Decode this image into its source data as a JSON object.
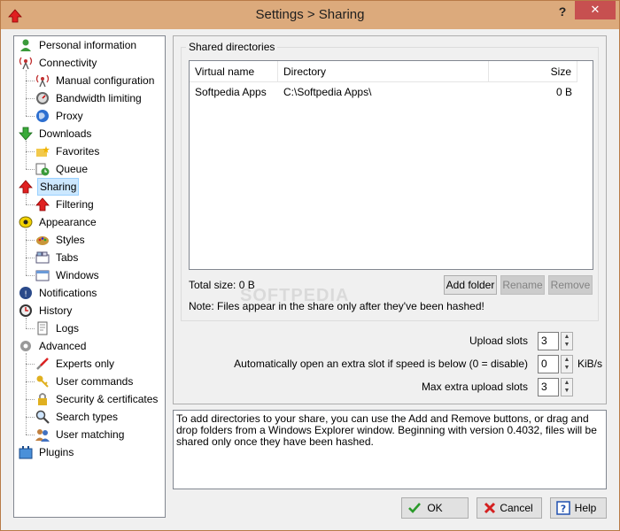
{
  "window": {
    "title": "Settings > Sharing",
    "help_label": "?",
    "close_label": "✕"
  },
  "tree": [
    {
      "label": "Personal information",
      "icon": "person-icon",
      "level": 0
    },
    {
      "label": "Connectivity",
      "icon": "antenna-icon",
      "level": 0
    },
    {
      "label": "Manual configuration",
      "icon": "antenna-small-icon",
      "level": 1
    },
    {
      "label": "Bandwidth limiting",
      "icon": "gauge-icon",
      "level": 1
    },
    {
      "label": "Proxy",
      "icon": "globe-icon",
      "level": 1
    },
    {
      "label": "Downloads",
      "icon": "down-arrow-icon",
      "level": 0
    },
    {
      "label": "Favorites",
      "icon": "folder-star-icon",
      "level": 1
    },
    {
      "label": "Queue",
      "icon": "queue-clock-icon",
      "level": 1
    },
    {
      "label": "Sharing",
      "icon": "up-arrow-icon",
      "level": 0,
      "selected": true
    },
    {
      "label": "Filtering",
      "icon": "filter-arrow-icon",
      "level": 1
    },
    {
      "label": "Appearance",
      "icon": "eye-icon",
      "level": 0
    },
    {
      "label": "Styles",
      "icon": "palette-icon",
      "level": 1
    },
    {
      "label": "Tabs",
      "icon": "tabs-icon",
      "level": 1
    },
    {
      "label": "Windows",
      "icon": "windows-icon",
      "level": 1
    },
    {
      "label": "Notifications",
      "icon": "notification-icon",
      "level": 0
    },
    {
      "label": "History",
      "icon": "clock-icon",
      "level": 0
    },
    {
      "label": "Logs",
      "icon": "log-icon",
      "level": 1
    },
    {
      "label": "Advanced",
      "icon": "gear-icon",
      "level": 0
    },
    {
      "label": "Experts only",
      "icon": "tools-icon",
      "level": 1
    },
    {
      "label": "User commands",
      "icon": "key-icon",
      "level": 1
    },
    {
      "label": "Security & certificates",
      "icon": "lock-icon",
      "level": 1
    },
    {
      "label": "Search types",
      "icon": "magnifier-icon",
      "level": 1
    },
    {
      "label": "User matching",
      "icon": "users-icon",
      "level": 1
    },
    {
      "label": "Plugins",
      "icon": "plugin-icon",
      "level": 0
    }
  ],
  "shared": {
    "group_label": "Shared directories",
    "columns": [
      "Virtual name",
      "Directory",
      "Size"
    ],
    "rows": [
      [
        "Softpedia Apps",
        "C:\\Softpedia Apps\\",
        "0 B"
      ]
    ],
    "total_label": "Total size: 0 B",
    "add_folder": "Add folder",
    "rename": "Rename",
    "remove": "Remove",
    "note": "Note: Files appear in the share only after they've been hashed!"
  },
  "slots": {
    "upload_label": "Upload slots",
    "upload_value": "3",
    "extra_label": "Automatically open an extra slot if speed is below (0 = disable)",
    "extra_value": "0",
    "extra_unit": "KiB/s",
    "max_label": "Max extra upload slots",
    "max_value": "3"
  },
  "description": "To add directories to your share, you can use the Add and Remove buttons, or drag and drop folders from a Windows Explorer window. Beginning with version 0.4032, files will be shared only once they have been hashed.",
  "buttons": {
    "ok": "OK",
    "cancel": "Cancel",
    "help": "Help"
  },
  "watermark": "SOFTPEDIA",
  "colors": {
    "titlebar": "#dcaa7c",
    "close": "#c75050",
    "selection": "#cce8ff"
  }
}
